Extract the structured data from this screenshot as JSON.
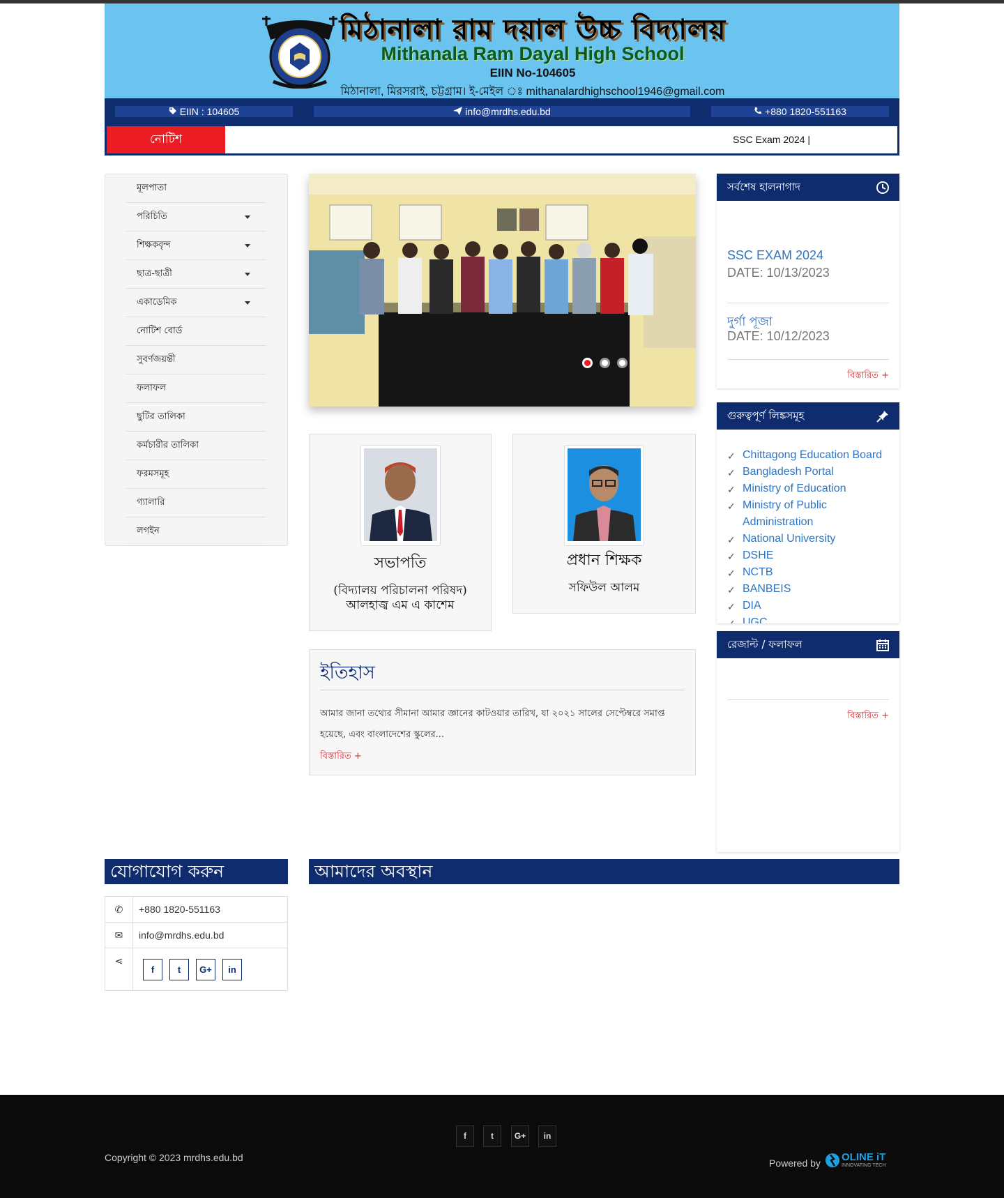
{
  "banner": {
    "title_bn": "মিঠানালা রাম দয়াল উচ্চ বিদ্যালয়",
    "title_en": "Mithanala Ram Dayal High School",
    "eiin": "EIIN No-104605",
    "address": "মিঠানালা, মিরসরাই, চট্টগ্রাম। ই-মেইল ঃ mithanalardhighschool1946@gmail.com"
  },
  "infobar": {
    "eiin": "EIIN : 104605",
    "email": "info@mrdhs.edu.bd",
    "phone": "+880 1820-551163"
  },
  "notice": {
    "label": "নোটিশ",
    "ticker": "SSC Exam 2024    |"
  },
  "menu": {
    "items": [
      {
        "label": "মূলপাতা",
        "dropdown": false
      },
      {
        "label": "পরিচিতি",
        "dropdown": true
      },
      {
        "label": "শিক্ষকবৃন্দ",
        "dropdown": true
      },
      {
        "label": "ছাত্র-ছাত্রী",
        "dropdown": true
      },
      {
        "label": "একাডেমিক",
        "dropdown": true
      },
      {
        "label": "নোটিশ বোর্ড",
        "dropdown": false
      },
      {
        "label": "সুবর্ণজয়ন্তী",
        "dropdown": false
      },
      {
        "label": "ফলাফল",
        "dropdown": false
      },
      {
        "label": "ছুটির তালিকা",
        "dropdown": false
      },
      {
        "label": "কর্মচারীর তালিকা",
        "dropdown": false
      },
      {
        "label": "ফরমসমূহ",
        "dropdown": false
      },
      {
        "label": "গ্যালারি",
        "dropdown": false
      },
      {
        "label": "লগইন",
        "dropdown": false
      }
    ]
  },
  "slider": {
    "slide_count": 3,
    "active_index": 0
  },
  "president": {
    "role": "সভাপতি",
    "org": "(বিদ্যালয় পরিচালনা পরিষদ)",
    "name": "আলহাজ্ব এম এ কাশেম"
  },
  "headmaster": {
    "role": "প্রধান শিক্ষক",
    "name": "সফিউল আলম"
  },
  "history": {
    "title": "ইতিহাস",
    "text": "আমার জানা তথ্যের সীমানা আমার জ্ঞানের কাটওয়ার তারিখ, যা ২০২১ সালের সেপ্টেম্বরে সমাপ্ত হয়েছে, এবং বাংলাদেশের স্কুলের...",
    "more": "বিস্তারিত +"
  },
  "updates": {
    "title": "সর্বশেষ হালনাগাদ",
    "items": [
      {
        "title": "SSC EXAM 2024",
        "date": "DATE: 10/13/2023"
      },
      {
        "title": "দুর্গা পূজা",
        "date": "DATE: 10/12/2023"
      }
    ],
    "more": "বিস্তারিত +"
  },
  "links": {
    "title": "গুরুত্বপূর্ণ লিঙ্কসমূহ",
    "check": "✓",
    "items": [
      "Chittagong Education Board",
      "Bangladesh Portal",
      "Ministry of Education",
      "Ministry of Public Administration",
      "National University",
      "DSHE",
      "NCTB",
      "BANBEIS",
      "DIA",
      "UGC"
    ]
  },
  "results": {
    "title": "রেজাল্ট / ফলাফল",
    "more": "বিস্তারিত +"
  },
  "contact": {
    "title": "যোগাযোগ করুন",
    "phone_icon": "✆",
    "phone": "+880 1820-551163",
    "email_icon": "✉",
    "email": "info@mrdhs.edu.bd",
    "share_icon": "⋖",
    "social": [
      "f",
      "t",
      "G+",
      "in"
    ]
  },
  "location": {
    "title": "আমাদের অবস্থান"
  },
  "footer": {
    "social": [
      "f",
      "t",
      "G+",
      "in"
    ],
    "copyright": "Copyright © 2023 mrdhs.edu.bd",
    "powered": "Powered by",
    "brand": "OLINE iT",
    "tagline": "INNOVATING TECH"
  },
  "colors": {
    "navy": "#0f2c6e",
    "accent_red": "#ec1c24",
    "banner_blue": "#6bc3f0",
    "link_blue": "#2f74c0"
  }
}
